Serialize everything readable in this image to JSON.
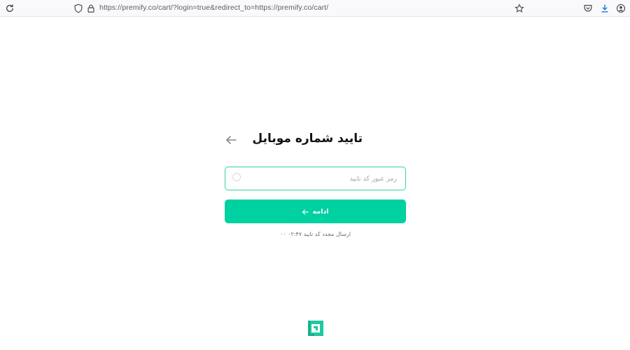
{
  "browser": {
    "url": "https://premify.co/cart/?login=true&redirect_to=https://premify.co/cart/",
    "icons": {
      "reload": "reload-icon",
      "shield": "shield-icon",
      "lock": "lock-icon",
      "bookmark": "star-icon",
      "pocket": "pocket-icon",
      "downloads": "download-icon",
      "account": "account-icon"
    }
  },
  "main": {
    "title": "تایید شماره موبایل",
    "code_input": {
      "value": "",
      "placeholder": "رمز عبور کد تایید"
    },
    "continue_label": "ادامه",
    "resend": "ارسال مجدد کد تایید ۰۲:۴۷ ۰۰"
  },
  "colors": {
    "accent": "#00d1a0",
    "input_border": "#2fd3a8"
  }
}
